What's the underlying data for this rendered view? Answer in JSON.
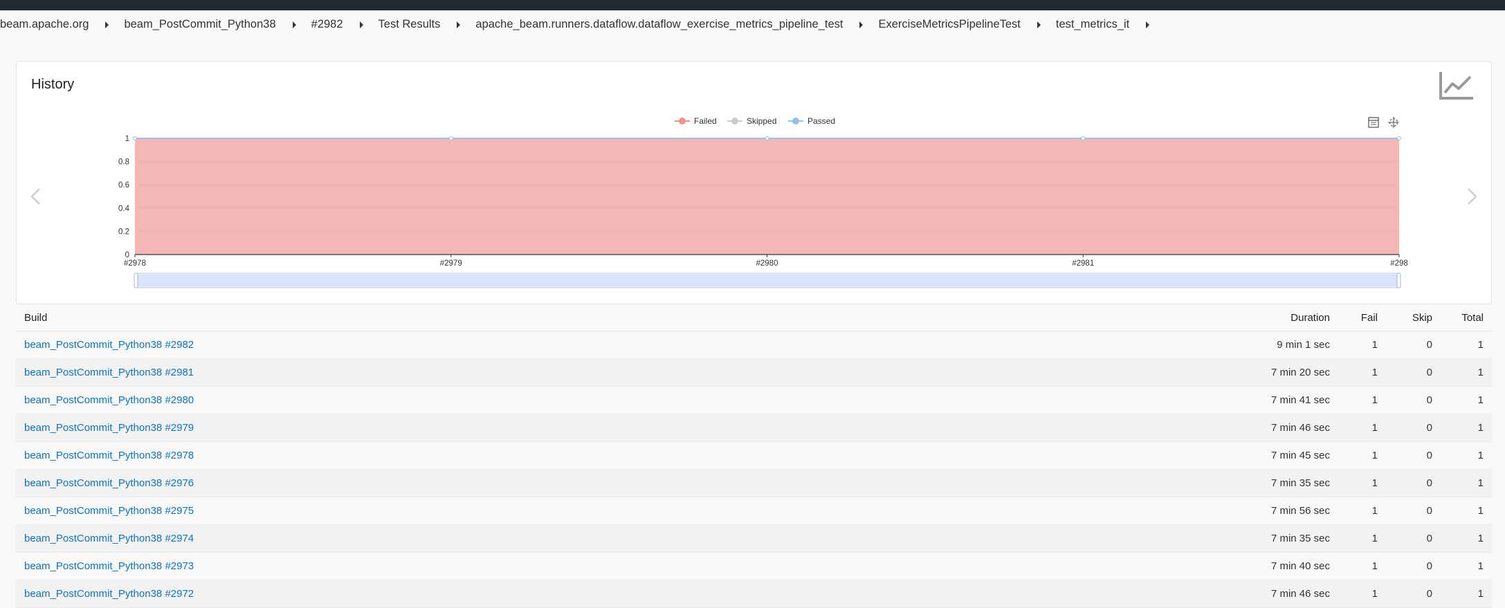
{
  "breadcrumbs": [
    {
      "label": "beam.apache.org"
    },
    {
      "label": "beam_PostCommit_Python38"
    },
    {
      "label": "#2982"
    },
    {
      "label": "Test Results"
    },
    {
      "label": "apache_beam.runners.dataflow.dataflow_exercise_metrics_pipeline_test"
    },
    {
      "label": "ExerciseMetricsPipelineTest"
    },
    {
      "label": "test_metrics_it"
    }
  ],
  "history": {
    "title": "History"
  },
  "chart_data": {
    "type": "area",
    "x": [
      "#2978",
      "#2979",
      "#2980",
      "#2981",
      "#298"
    ],
    "series": [
      {
        "name": "Failed",
        "values": [
          1,
          1,
          1,
          1,
          1
        ],
        "color": "#ef8f8f"
      },
      {
        "name": "Skipped",
        "values": [
          0,
          0,
          0,
          0,
          0
        ],
        "color": "#cccccc"
      },
      {
        "name": "Passed",
        "values": [
          0,
          0,
          0,
          0,
          0
        ],
        "color": "#8fc1f2"
      }
    ],
    "yticks": [
      "0",
      "0.2",
      "0.4",
      "0.6",
      "0.8",
      "1"
    ],
    "ylim": [
      0,
      1
    ],
    "legend": "top-center",
    "grid": true
  },
  "table": {
    "headers": {
      "build": "Build",
      "duration": "Duration",
      "fail": "Fail",
      "skip": "Skip",
      "total": "Total"
    },
    "rows": [
      {
        "build": "beam_PostCommit_Python38 #2982",
        "duration": "9 min 1 sec",
        "fail": "1",
        "skip": "0",
        "total": "1"
      },
      {
        "build": "beam_PostCommit_Python38 #2981",
        "duration": "7 min 20 sec",
        "fail": "1",
        "skip": "0",
        "total": "1"
      },
      {
        "build": "beam_PostCommit_Python38 #2980",
        "duration": "7 min 41 sec",
        "fail": "1",
        "skip": "0",
        "total": "1"
      },
      {
        "build": "beam_PostCommit_Python38 #2979",
        "duration": "7 min 46 sec",
        "fail": "1",
        "skip": "0",
        "total": "1"
      },
      {
        "build": "beam_PostCommit_Python38 #2978",
        "duration": "7 min 45 sec",
        "fail": "1",
        "skip": "0",
        "total": "1"
      },
      {
        "build": "beam_PostCommit_Python38 #2976",
        "duration": "7 min 35 sec",
        "fail": "1",
        "skip": "0",
        "total": "1"
      },
      {
        "build": "beam_PostCommit_Python38 #2975",
        "duration": "7 min 56 sec",
        "fail": "1",
        "skip": "0",
        "total": "1"
      },
      {
        "build": "beam_PostCommit_Python38 #2974",
        "duration": "7 min 35 sec",
        "fail": "1",
        "skip": "0",
        "total": "1"
      },
      {
        "build": "beam_PostCommit_Python38 #2973",
        "duration": "7 min 40 sec",
        "fail": "1",
        "skip": "0",
        "total": "1"
      },
      {
        "build": "beam_PostCommit_Python38 #2972",
        "duration": "7 min 46 sec",
        "fail": "1",
        "skip": "0",
        "total": "1"
      }
    ]
  },
  "icons": {
    "trend": "line-chart-icon",
    "prev": "chevron-left-icon",
    "next": "chevron-right-icon",
    "data_view": "data-view-icon",
    "restore": "restore-icon"
  }
}
